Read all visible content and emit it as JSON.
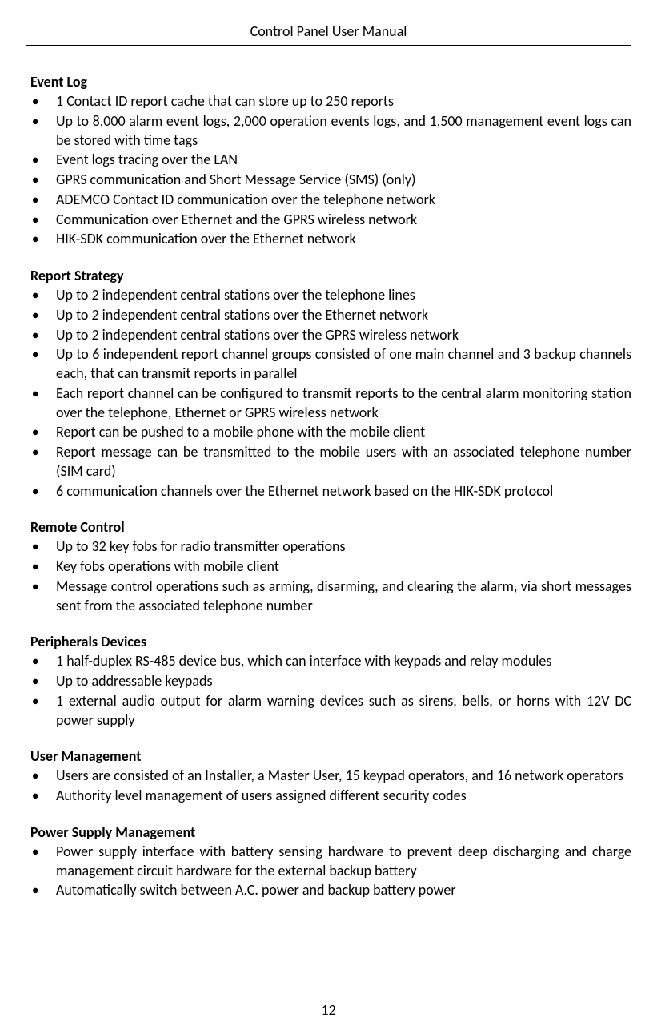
{
  "header": {
    "title": "Control Panel User Manual"
  },
  "sections": {
    "event_log": {
      "heading": "Event Log",
      "items": [
        "1 Contact ID report cache that can store up to 250 reports",
        "Up to 8,000 alarm event logs, 2,000 operation events logs, and 1,500 management event logs can be stored with time tags",
        "Event logs tracing over the LAN",
        "GPRS communication and Short Message Service (SMS) (only)",
        "ADEMCO Contact ID communication over the telephone network",
        "Communication over Ethernet and the GPRS wireless network",
        "HIK-SDK communication over the Ethernet network"
      ]
    },
    "report_strategy": {
      "heading": "Report Strategy",
      "items": [
        "Up to 2 independent central stations over the telephone lines",
        "Up to 2 independent central stations over the Ethernet network",
        "Up to 2 independent central stations over the GPRS wireless network",
        "Up to 6 independent report channel groups consisted of one main channel and 3 backup channels each, that can transmit reports in parallel",
        "Each report channel can be configured to transmit reports to the central alarm monitoring station over the telephone, Ethernet or GPRS wireless network",
        "Report can be pushed to a mobile phone with the mobile client",
        "Report message can be transmitted to the mobile users with an associated telephone number (SIM card)",
        "6 communication channels over the Ethernet network based on the HIK-SDK protocol"
      ]
    },
    "remote_control": {
      "heading": "Remote Control",
      "items": [
        "Up to 32 key fobs for radio transmitter operations",
        "Key fobs operations with mobile client",
        "Message control operations such as arming, disarming, and clearing the alarm, via short messages sent from the associated telephone number"
      ]
    },
    "peripherals_devices": {
      "heading": "Peripherals Devices",
      "items": [
        "1 half-duplex RS-485 device bus, which can interface with keypads and relay modules",
        "Up to   addressable keypads",
        "1 external audio output for alarm warning devices such as sirens, bells, or horns with 12V DC power supply"
      ]
    },
    "user_management": {
      "heading": "User Management",
      "items": [
        "Users are consisted of an Installer, a Master User, 15 keypad operators, and 16 network operators",
        "Authority level management of users assigned different security codes"
      ]
    },
    "power_supply_management": {
      "heading": "Power Supply Management",
      "items": [
        "Power supply interface with battery sensing hardware to prevent deep discharging and charge management circuit hardware for the external backup battery",
        "Automatically switch between A.C. power and backup battery power"
      ]
    }
  },
  "page_number": "12"
}
